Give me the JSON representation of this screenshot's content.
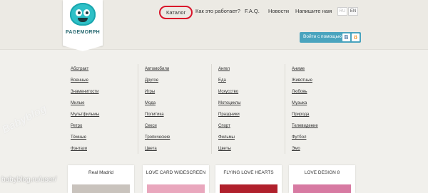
{
  "logo": {
    "text": "PAGEMORPH"
  },
  "nav": {
    "items": [
      "Каталог",
      "Как это работает?",
      "F.A.Q.",
      "Новости",
      "Напишите нам"
    ]
  },
  "lang": {
    "ru": "RU",
    "en": "EN"
  },
  "login": {
    "label": "Войти с помощью",
    "vk": "В",
    "ok": "ö"
  },
  "catalog": {
    "columns": [
      [
        "Абстракт",
        "Военные",
        "Знаменитости",
        "Милые",
        "Мультфильмы",
        "Ретро",
        "Тёмные",
        "Фэнтази"
      ],
      [
        "Автомобили",
        "Другое",
        "Игры",
        "Мода",
        "Политика",
        "Секси",
        "Тропические",
        "Цвета"
      ],
      [
        "Ангел",
        "Еда",
        "Искусство",
        "Мотоциклы",
        "Праздники",
        "Спорт",
        "Фильмы",
        "Цветы"
      ],
      [
        "Аниме",
        "Животные",
        "Любовь",
        "Музыка",
        "Природа",
        "Телевидение",
        "Футбол",
        "Эмо"
      ]
    ]
  },
  "cards": [
    {
      "title": "Real Madrid",
      "thumb_color": "#c9c3bd"
    },
    {
      "title": "LOVE CARD WIDESCREEN",
      "thumb_color": "#e9a7bd"
    },
    {
      "title": "FLYING LOVE HEARTS",
      "thumb_color": "#b0202c"
    },
    {
      "title": "LOVE DESIGN 8",
      "thumb_color": "#d77aa2"
    }
  ],
  "watermark": {
    "logo": "Babyblog",
    "url": "babyblog.ru/user/"
  },
  "colors": {
    "accent": "#4aa4be",
    "highlight": "#d9142a",
    "brand": "#2ec0c7"
  }
}
